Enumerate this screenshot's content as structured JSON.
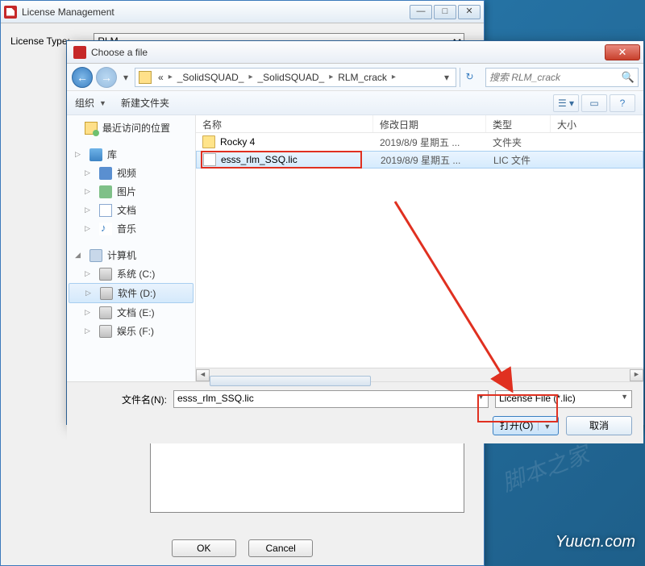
{
  "bg_window": {
    "title": "License Management",
    "label_license_type": "License Type:",
    "select_value": "RLM",
    "ok": "OK",
    "cancel": "Cancel"
  },
  "dialog": {
    "title": "Choose a file",
    "breadcrumb": {
      "segs": [
        "«",
        "_SolidSQUAD_",
        "_SolidSQUAD_",
        "RLM_crack"
      ]
    },
    "search_placeholder": "搜索 RLM_crack",
    "toolbar": {
      "organize": "组织",
      "new_folder": "新建文件夹"
    },
    "sidebar": {
      "recent": "最近访问的位置",
      "library": "库",
      "videos": "视频",
      "pictures": "图片",
      "documents": "文档",
      "music": "音乐",
      "computer": "计算机",
      "drive_c": "系统 (C:)",
      "drive_d": "软件 (D:)",
      "drive_e": "文档 (E:)",
      "drive_f": "娱乐 (F:)"
    },
    "columns": {
      "name": "名称",
      "date": "修改日期",
      "type": "类型",
      "size": "大小"
    },
    "rows": [
      {
        "name": "Rocky 4",
        "date": "2019/8/9 星期五 ...",
        "type": "文件夹",
        "is_folder": true
      },
      {
        "name": "esss_rlm_SSQ.lic",
        "date": "2019/8/9 星期五 ...",
        "type": "LIC 文件",
        "is_folder": false,
        "selected": true
      }
    ],
    "filename_label": "文件名(N):",
    "filename_value": "esss_rlm_SSQ.lic",
    "filter": "License File (*.lic)",
    "open": "打开(O)",
    "cancel": "取消"
  },
  "watermark_corner": "Yuucn.com"
}
